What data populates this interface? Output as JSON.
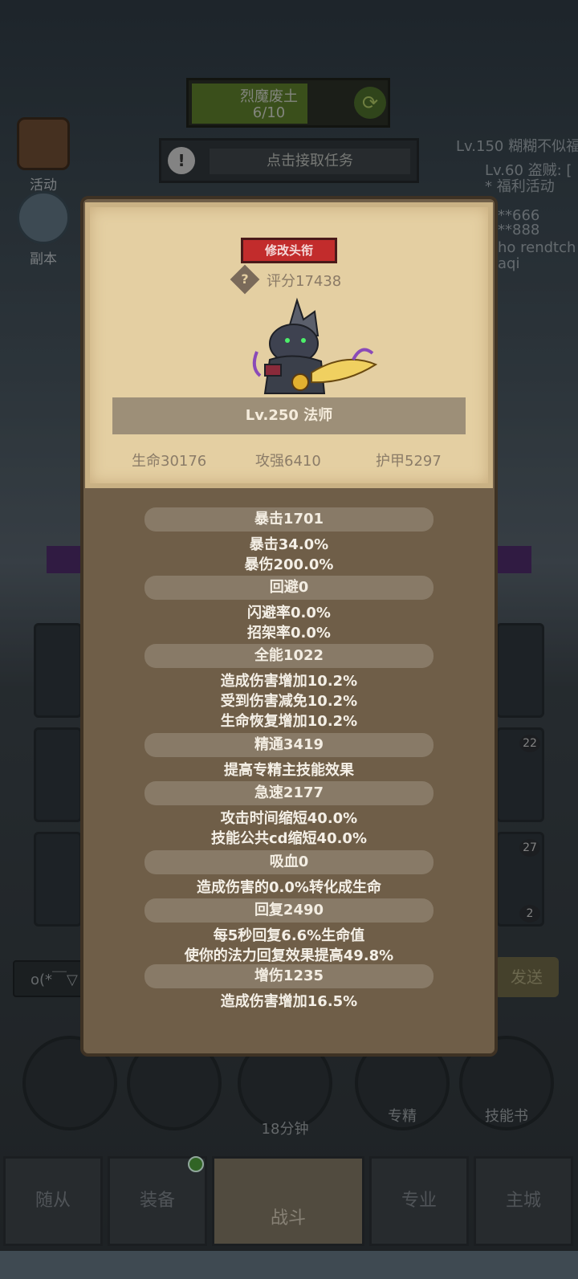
{
  "quest": {
    "title": "烈魔废土",
    "progress": "6/10",
    "progress_fraction": 0.6
  },
  "task": {
    "label": "点击接取任务"
  },
  "side_buttons": [
    {
      "label": "活动"
    },
    {
      "label": "副本"
    }
  ],
  "right_info": [
    "Lv.150 糊糊不似福",
    "Lv.60 盗贼: [",
    "* 福利活动",
    "**666",
    "**888",
    "ho rendtch",
    "aqi"
  ],
  "card_badges": [
    "22",
    "27",
    "2"
  ],
  "chat": {
    "placeholder": "o(*￣▽",
    "send_label": "发送"
  },
  "bottom_actions": [
    {
      "label": ""
    },
    {
      "label": ""
    },
    {
      "label": "18分钟"
    },
    {
      "label": "专精"
    },
    {
      "label": "技能书"
    }
  ],
  "nav": [
    {
      "label": "随从"
    },
    {
      "label": "装备"
    },
    {
      "label": "战斗"
    },
    {
      "label": "专业"
    },
    {
      "label": "主城"
    }
  ],
  "profile": {
    "edit_title_button": "修改头衔",
    "score_icon": "?",
    "score": "评分17438",
    "level_class": "Lv.250 法师",
    "hp": "生命30176",
    "attack": "攻强6410",
    "armor": "护甲5297"
  },
  "stats": [
    {
      "header": "暴击1701",
      "lines": [
        "暴击34.0%",
        "暴伤200.0%"
      ]
    },
    {
      "header": "回避0",
      "lines": [
        "闪避率0.0%",
        "招架率0.0%"
      ]
    },
    {
      "header": "全能1022",
      "lines": [
        "造成伤害增加10.2%",
        "受到伤害减免10.2%",
        "生命恢复增加10.2%"
      ]
    },
    {
      "header": "精通3419",
      "lines": [
        "提高专精主技能效果"
      ]
    },
    {
      "header": "急速2177",
      "lines": [
        "攻击时间缩短40.0%",
        "技能公共cd缩短40.0%"
      ]
    },
    {
      "header": "吸血0",
      "lines": [
        "造成伤害的0.0%转化成生命"
      ]
    },
    {
      "header": "回复2490",
      "lines": [
        "每5秒回复6.6%生命值",
        "使你的法力回复效果提高49.8%"
      ]
    },
    {
      "header": "增伤1235",
      "lines": [
        "造成伤害增加16.5%"
      ]
    }
  ]
}
